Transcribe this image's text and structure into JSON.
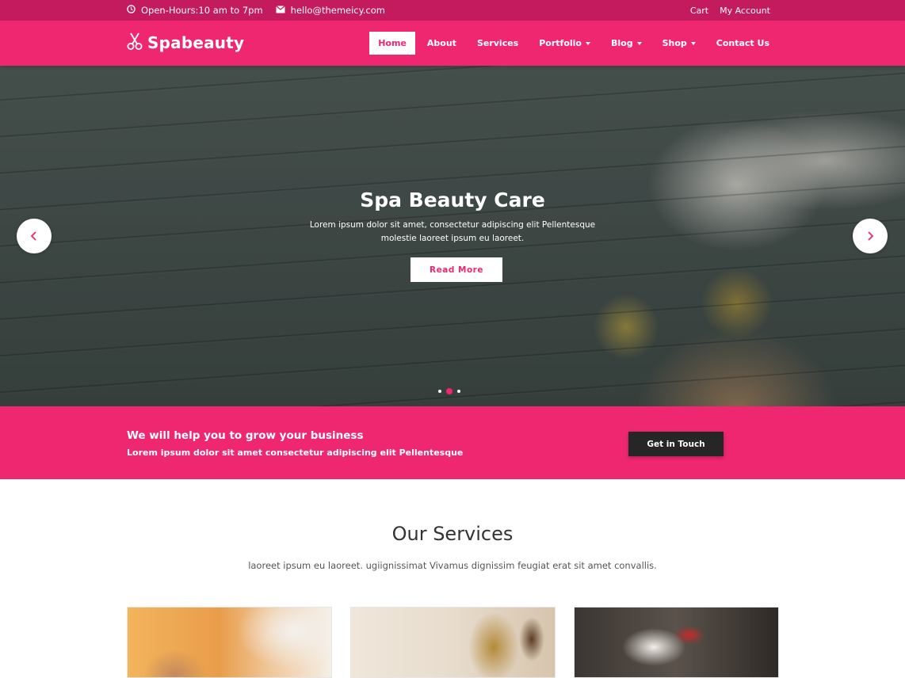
{
  "topbar": {
    "hours": "Open-Hours:10 am to 7pm",
    "email": "hello@themeicy.com",
    "links": [
      "Cart",
      "My Account"
    ]
  },
  "header": {
    "logo": "Spabeauty",
    "nav": [
      "Home",
      "About",
      "Services",
      "Portfolio",
      "Blog",
      "Shop",
      "Contact Us"
    ],
    "active_nav": "Home"
  },
  "hero": {
    "title": "Spa Beauty Care",
    "text": "Lorem ipsum dolor sit amet, consectetur adipiscing elit Pellentesque molestie laoreet ipsum eu laoreet.",
    "button": "Read More",
    "slides": 3,
    "active_slide": 2
  },
  "cta": {
    "title": "We will help you to grow your business",
    "text": "Lorem ipsum dolor sit amet consectetur adipiscing elit Pellentesque",
    "button": "Get in Touch"
  },
  "services": {
    "title": "Our Services",
    "subtitle": "laoreet ipsum eu laoreet. ugiignissimat Vivamus dignissim feugiat erat sit amet convallis."
  },
  "colors": {
    "brand": "#ee2770",
    "topbar": "#c41a5e",
    "cta_button": "#262626"
  }
}
